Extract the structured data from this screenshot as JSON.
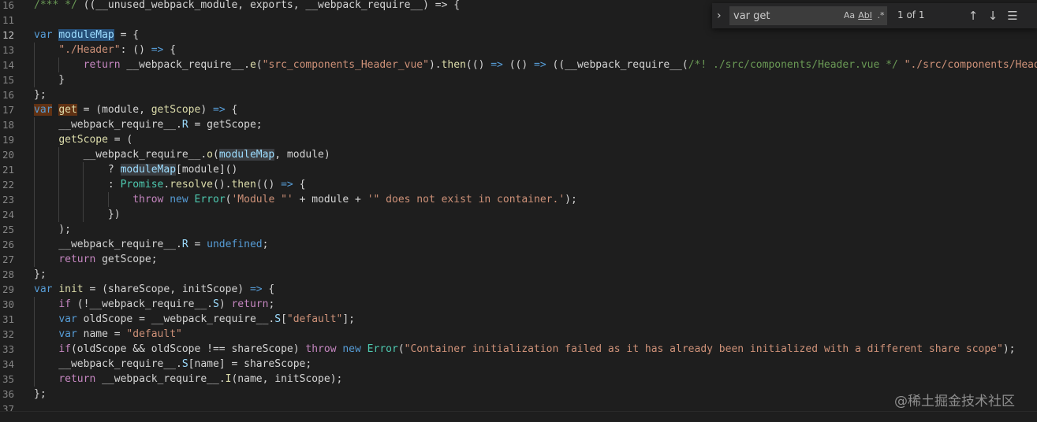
{
  "editor": {
    "lines": [
      {
        "n": "16",
        "active": false,
        "tokens": [
          [
            "/",
            "cmt"
          ],
          [
            "*** */ ",
            "cmt"
          ],
          [
            "((__unused_webpack_module, exports, __webpack_require__) => {",
            ""
          ]
        ]
      },
      {
        "n": "11",
        "active": false,
        "tokens": []
      },
      {
        "n": "12",
        "active": true,
        "tokens": [
          [
            "var",
            "kw"
          ],
          [
            " ",
            ""
          ],
          [
            "moduleMap",
            "var hl2"
          ],
          [
            " = {",
            ""
          ]
        ]
      },
      {
        "n": "13",
        "active": false,
        "tokens": [
          [
            "    ",
            ""
          ],
          [
            "\"./Header\"",
            "str"
          ],
          [
            ": () ",
            ""
          ],
          [
            "=>",
            "kw"
          ],
          [
            " {",
            ""
          ]
        ]
      },
      {
        "n": "14",
        "active": false,
        "tokens": [
          [
            "        ",
            ""
          ],
          [
            "return",
            "kw2"
          ],
          [
            " __webpack_require__.",
            ""
          ],
          [
            "e",
            "fn"
          ],
          [
            "(",
            ""
          ],
          [
            "\"src_components_Header_vue\"",
            "str"
          ],
          [
            ").",
            ""
          ],
          [
            "then",
            "fn"
          ],
          [
            "(() ",
            ""
          ],
          [
            "=>",
            "kw"
          ],
          [
            " (() ",
            ""
          ],
          [
            "=>",
            "kw"
          ],
          [
            " ((__webpack_require__(",
            ""
          ],
          [
            "/*! ./src/components/Header.vue */",
            "cmt"
          ],
          [
            " ",
            ""
          ],
          [
            "\"./src/components/Header",
            "str"
          ]
        ]
      },
      {
        "n": "15",
        "active": false,
        "tokens": [
          [
            "    }",
            ""
          ]
        ]
      },
      {
        "n": "16",
        "active": false,
        "tokens": [
          [
            "};",
            ""
          ]
        ]
      },
      {
        "n": "17",
        "active": false,
        "tokens": [
          [
            "var",
            "kw hl"
          ],
          [
            " ",
            ""
          ],
          [
            "get",
            "fn hl"
          ],
          [
            " = (module, ",
            ""
          ],
          [
            "getScope",
            "fn"
          ],
          [
            ") ",
            ""
          ],
          [
            "=>",
            "kw"
          ],
          [
            " {",
            ""
          ]
        ]
      },
      {
        "n": "18",
        "active": false,
        "tokens": [
          [
            "    __webpack_require__.",
            ""
          ],
          [
            "R",
            "var"
          ],
          [
            " = getScope;",
            ""
          ]
        ]
      },
      {
        "n": "19",
        "active": false,
        "tokens": [
          [
            "    ",
            ""
          ],
          [
            "getScope",
            "fn"
          ],
          [
            " = (",
            ""
          ]
        ]
      },
      {
        "n": "20",
        "active": false,
        "tokens": [
          [
            "        __webpack_require__.",
            ""
          ],
          [
            "o",
            "fn"
          ],
          [
            "(",
            ""
          ],
          [
            "moduleMap",
            "var hl3"
          ],
          [
            ", module)",
            ""
          ]
        ]
      },
      {
        "n": "21",
        "active": false,
        "tokens": [
          [
            "            ? ",
            ""
          ],
          [
            "moduleMap",
            "var hl3"
          ],
          [
            "[module]()",
            ""
          ]
        ]
      },
      {
        "n": "22",
        "active": false,
        "tokens": [
          [
            "            : ",
            ""
          ],
          [
            "Promise",
            "cls"
          ],
          [
            ".",
            ""
          ],
          [
            "resolve",
            "fn"
          ],
          [
            "().",
            ""
          ],
          [
            "then",
            "fn"
          ],
          [
            "(() ",
            ""
          ],
          [
            "=>",
            "kw"
          ],
          [
            " {",
            ""
          ]
        ]
      },
      {
        "n": "23",
        "active": false,
        "tokens": [
          [
            "                ",
            ""
          ],
          [
            "throw",
            "kw2"
          ],
          [
            " ",
            ""
          ],
          [
            "new",
            "kw"
          ],
          [
            " ",
            ""
          ],
          [
            "Error",
            "cls"
          ],
          [
            "(",
            ""
          ],
          [
            "'Module \"'",
            "str"
          ],
          [
            " + module + ",
            ""
          ],
          [
            "'\" does not exist in container.'",
            "str"
          ],
          [
            ");",
            ""
          ]
        ]
      },
      {
        "n": "24",
        "active": false,
        "tokens": [
          [
            "            })",
            ""
          ]
        ]
      },
      {
        "n": "25",
        "active": false,
        "tokens": [
          [
            "    );",
            ""
          ]
        ]
      },
      {
        "n": "26",
        "active": false,
        "tokens": [
          [
            "    __webpack_require__.",
            ""
          ],
          [
            "R",
            "var"
          ],
          [
            " = ",
            ""
          ],
          [
            "undefined",
            "kw"
          ],
          [
            ";",
            ""
          ]
        ]
      },
      {
        "n": "27",
        "active": false,
        "tokens": [
          [
            "    ",
            ""
          ],
          [
            "return",
            "kw2"
          ],
          [
            " getScope;",
            ""
          ]
        ]
      },
      {
        "n": "28",
        "active": false,
        "tokens": [
          [
            "};",
            ""
          ]
        ]
      },
      {
        "n": "29",
        "active": false,
        "tokens": [
          [
            "var",
            "kw"
          ],
          [
            " ",
            ""
          ],
          [
            "init",
            "fn"
          ],
          [
            " = (shareScope, initScope) ",
            ""
          ],
          [
            "=>",
            "kw"
          ],
          [
            " {",
            ""
          ]
        ]
      },
      {
        "n": "30",
        "active": false,
        "tokens": [
          [
            "    ",
            ""
          ],
          [
            "if",
            "kw2"
          ],
          [
            " (!__webpack_require__.",
            ""
          ],
          [
            "S",
            "var"
          ],
          [
            ") ",
            ""
          ],
          [
            "return",
            "kw2"
          ],
          [
            ";",
            ""
          ]
        ]
      },
      {
        "n": "31",
        "active": false,
        "tokens": [
          [
            "    ",
            ""
          ],
          [
            "var",
            "kw"
          ],
          [
            " oldScope = __webpack_require__.",
            ""
          ],
          [
            "S",
            "var"
          ],
          [
            "[",
            ""
          ],
          [
            "\"default\"",
            "str"
          ],
          [
            "];",
            ""
          ]
        ]
      },
      {
        "n": "32",
        "active": false,
        "tokens": [
          [
            "    ",
            ""
          ],
          [
            "var",
            "kw"
          ],
          [
            " name = ",
            ""
          ],
          [
            "\"default\"",
            "str"
          ]
        ]
      },
      {
        "n": "33",
        "active": false,
        "tokens": [
          [
            "    ",
            ""
          ],
          [
            "if",
            "kw2"
          ],
          [
            "(oldScope && oldScope !== shareScope) ",
            ""
          ],
          [
            "throw",
            "kw2"
          ],
          [
            " ",
            ""
          ],
          [
            "new",
            "kw"
          ],
          [
            " ",
            ""
          ],
          [
            "Error",
            "cls"
          ],
          [
            "(",
            ""
          ],
          [
            "\"Container initialization failed as it has already been initialized with a different share scope\"",
            "str"
          ],
          [
            ");",
            ""
          ]
        ]
      },
      {
        "n": "34",
        "active": false,
        "tokens": [
          [
            "    __webpack_require__.",
            ""
          ],
          [
            "S",
            "var"
          ],
          [
            "[name] = shareScope;",
            ""
          ]
        ]
      },
      {
        "n": "35",
        "active": false,
        "tokens": [
          [
            "    ",
            ""
          ],
          [
            "return",
            "kw2"
          ],
          [
            " __webpack_require__.",
            ""
          ],
          [
            "I",
            "fn"
          ],
          [
            "(name, initScope);",
            ""
          ]
        ]
      },
      {
        "n": "36",
        "active": false,
        "tokens": [
          [
            "};",
            ""
          ]
        ]
      },
      {
        "n": "37",
        "active": false,
        "tokens": []
      }
    ]
  },
  "find": {
    "toggle_icon": "chevron-right-icon",
    "query": "var get",
    "match_case_label": "Aa",
    "whole_word_label": "Abl",
    "regex_label": ".*",
    "count": "1 of 1",
    "prev_icon": "arrow-up-icon",
    "next_icon": "arrow-down-icon",
    "selection_icon": "find-in-selection-icon"
  },
  "watermark": "@稀土掘金技术社区",
  "colors": {
    "background": "#1e1e1e",
    "find_match": "#613214",
    "selection": "#264f78"
  }
}
